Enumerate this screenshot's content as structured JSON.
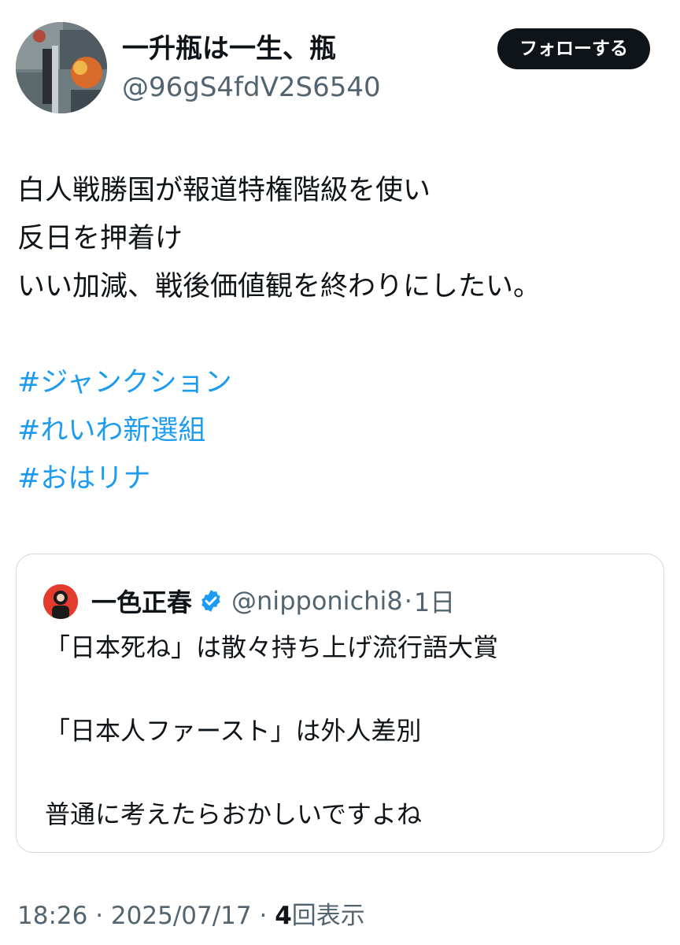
{
  "author": {
    "display_name": "一升瓶は一生、瓶",
    "handle": "@96gS4fdV2S6540",
    "avatar_icon": "abstract-painting-avatar"
  },
  "follow_button": {
    "label": "フォローする",
    "background": "#0f1419",
    "color": "#ffffff"
  },
  "tweet": {
    "lines": [
      "白人戦勝国が報道特権階級を使い",
      "反日を押着け",
      "いい加減、戦後価値観を終わりにしたい。"
    ],
    "hashtags": [
      "#ジャンクション",
      "#れいわ新選組",
      "#おはリナ"
    ],
    "hashtag_color": "#1d9bf0"
  },
  "quoted_tweet": {
    "name": "一色正春",
    "verified_icon": "verified-badge-icon",
    "verified_color": "#1d9bf0",
    "handle": "@nipponichi8",
    "separator": "·",
    "time": "1日",
    "lines": [
      "「日本死ね」は散々持ち上げ流行語大賞",
      "「日本人ファースト」は外人差別",
      "普通に考えたらおかしいですよね"
    ]
  },
  "meta": {
    "time": "18:26",
    "separator": "·",
    "date": "2025/07/17",
    "views_count": "4",
    "views_label": "回表示"
  },
  "colors": {
    "text_primary": "#0f1419",
    "text_secondary": "#536471",
    "border": "#cfd9de"
  }
}
